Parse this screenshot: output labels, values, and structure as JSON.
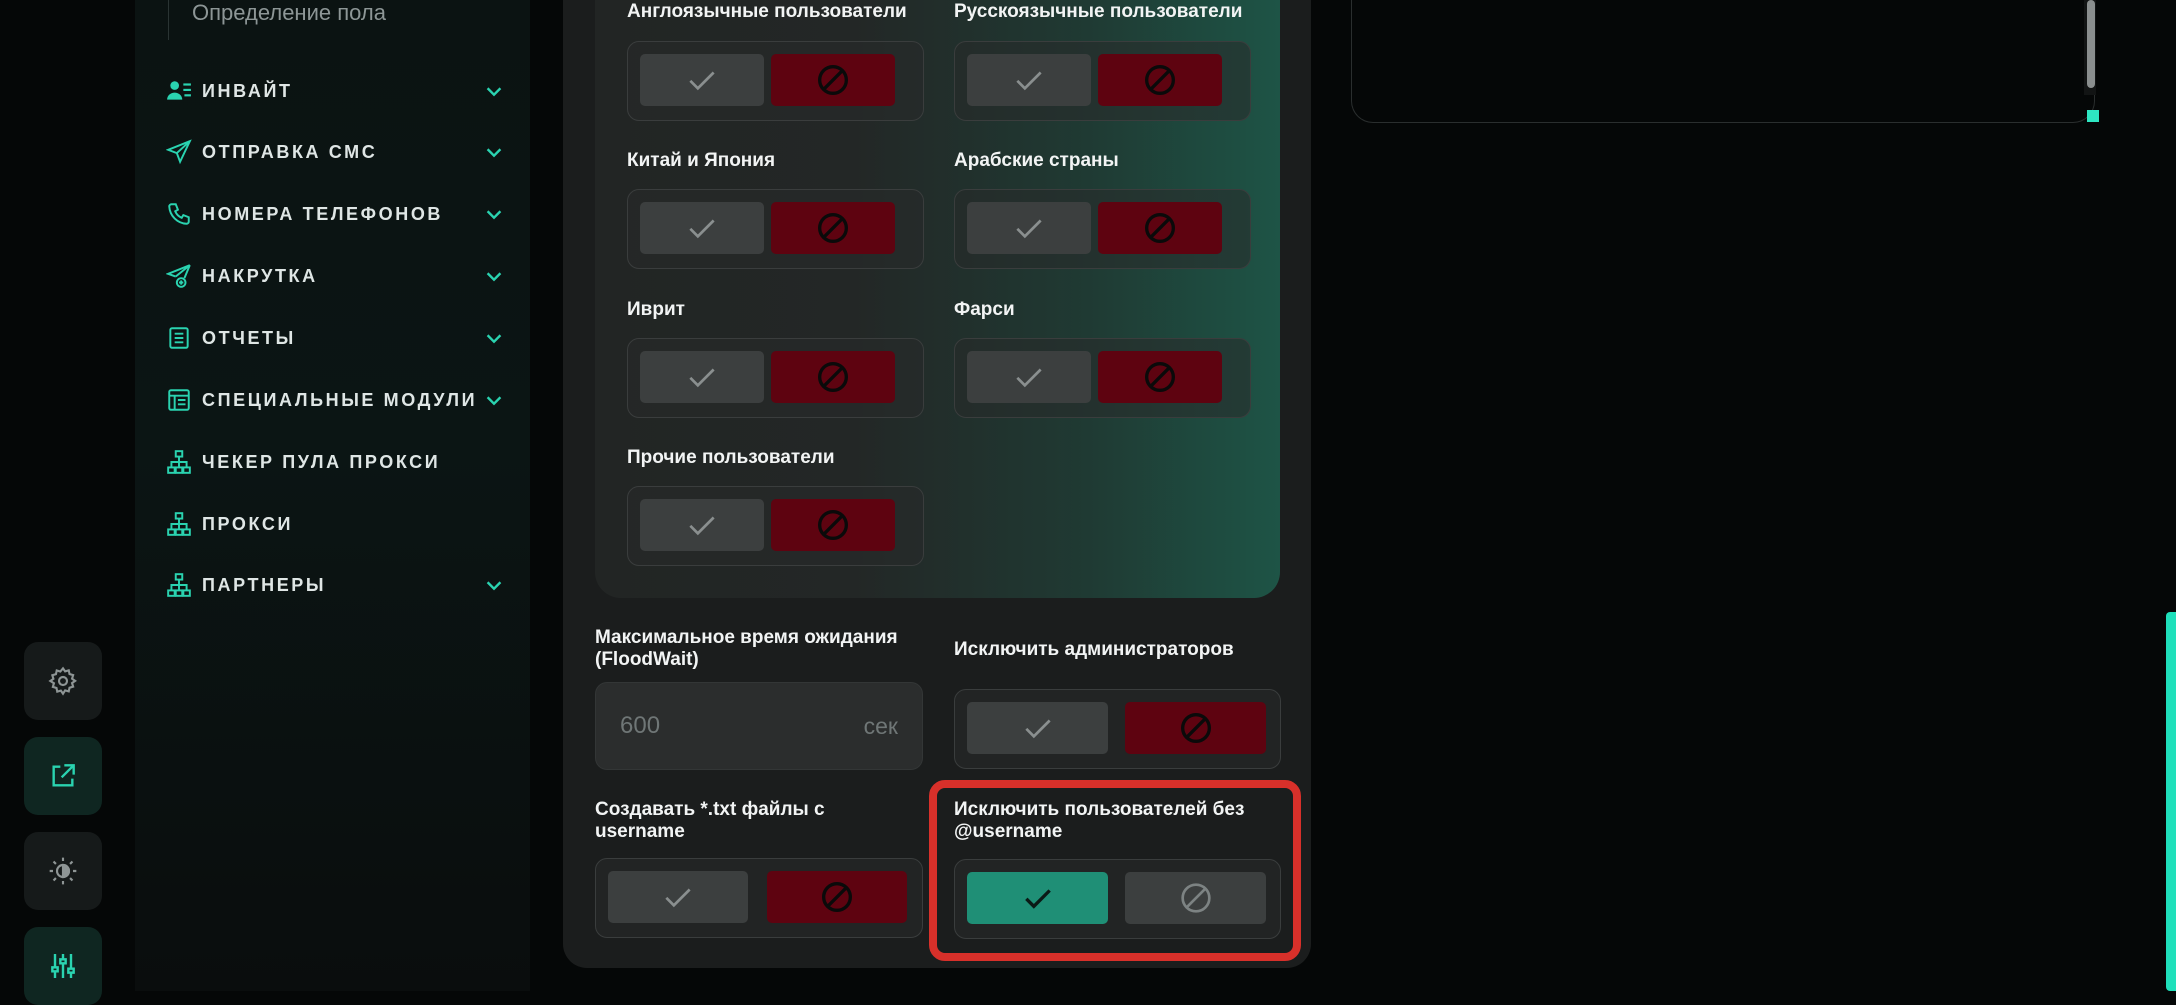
{
  "sidebar": {
    "sub_item": "Определение пола",
    "items": [
      {
        "label": "ИНВАЙТ",
        "icon": "invite-icon",
        "chevron": true
      },
      {
        "label": "ОТПРАВКА СМС",
        "icon": "send-icon",
        "chevron": true
      },
      {
        "label": "НОМЕРА ТЕЛЕФОНОВ",
        "icon": "phone-icon",
        "chevron": true
      },
      {
        "label": "НАКРУТКА",
        "icon": "send-plus-icon",
        "chevron": true
      },
      {
        "label": "ОТЧЕТЫ",
        "icon": "report-icon",
        "chevron": true
      },
      {
        "label": "СПЕЦИАЛЬНЫЕ МОДУЛИ",
        "icon": "modules-icon",
        "chevron": true
      },
      {
        "label": "ЧЕКЕР ПУЛА ПРОКСИ",
        "icon": "network-icon",
        "chevron": false
      },
      {
        "label": "ПРОКСИ",
        "icon": "network-icon",
        "chevron": false
      },
      {
        "label": "ПАРТНЕРЫ",
        "icon": "network-icon",
        "chevron": true
      }
    ]
  },
  "rail": [
    "gear-icon",
    "external-link-icon",
    "theme-icon",
    "sliders-icon"
  ],
  "languages": [
    {
      "label": "Англоязычные пользователи",
      "value": "excluded"
    },
    {
      "label": "Русскоязычные пользователи",
      "value": "excluded"
    },
    {
      "label": "Китай и Япония",
      "value": "excluded"
    },
    {
      "label": "Арабские страны",
      "value": "excluded"
    },
    {
      "label": "Иврит",
      "value": "excluded"
    },
    {
      "label": "Фарси",
      "value": "excluded"
    },
    {
      "label": "Прочие пользователи",
      "value": "excluded"
    }
  ],
  "floodwait": {
    "label": "Максимальное время ожидания (FloodWait)",
    "placeholder": "600",
    "unit": "сек"
  },
  "exclude_admins": {
    "label": "Исключить администраторов",
    "value": "excluded"
  },
  "create_txt": {
    "label": "Создавать *.txt файлы с username",
    "value": "excluded"
  },
  "exclude_no_username": {
    "label": "Исключить пользователей без @username",
    "value": "enabled"
  },
  "colors": {
    "accent": "#1f8f76",
    "danger": "#5e0310",
    "highlight": "#d8302a",
    "scroll": "#1fe0bb"
  }
}
